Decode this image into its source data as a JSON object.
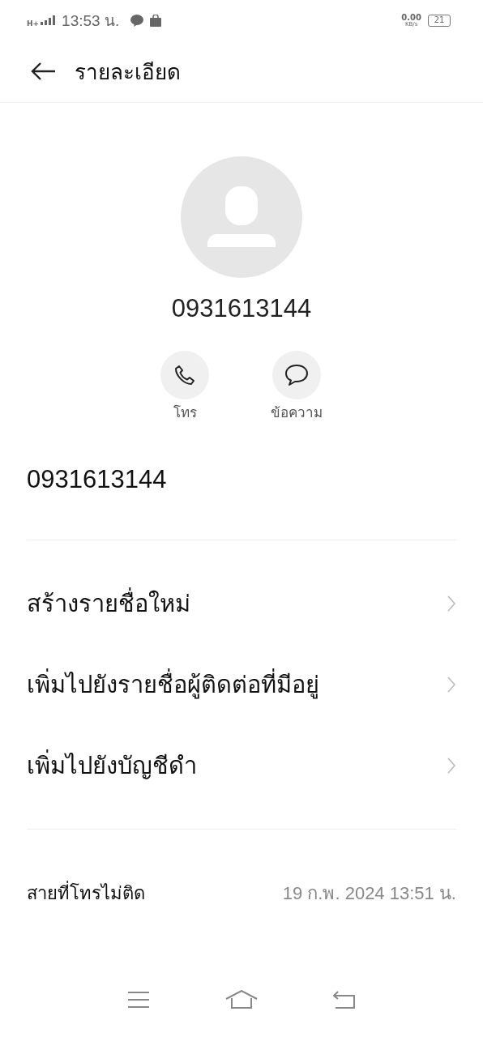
{
  "status_bar": {
    "network": "H+",
    "time": "13:53 น.",
    "speed_value": "0.00",
    "speed_unit": "KB/s",
    "battery": "21"
  },
  "header": {
    "title": "รายละเอียด"
  },
  "contact": {
    "name": "0931613144"
  },
  "actions": [
    {
      "kind": "call",
      "label": "โทร"
    },
    {
      "kind": "message",
      "label": "ข้อความ"
    }
  ],
  "number": "0931613144",
  "menu": [
    {
      "label": "สร้างรายชื่อใหม่"
    },
    {
      "label": "เพิ่มไปยังรายชื่อผู้ติดต่อที่มีอยู่"
    },
    {
      "label": "เพิ่มไปยังบัญชีดำ"
    }
  ],
  "call_log": [
    {
      "type": "สายที่โทรไม่ติด",
      "time": "19 ก.พ. 2024 13:51 น."
    }
  ]
}
